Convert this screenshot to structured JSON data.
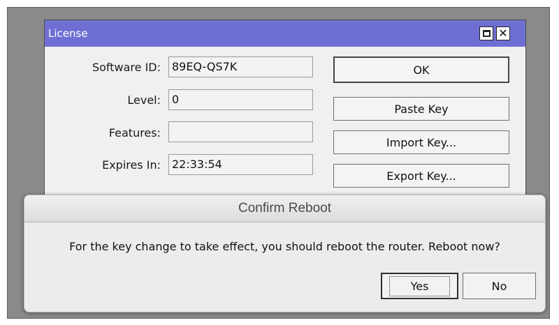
{
  "license_window": {
    "title": "License",
    "fields": [
      {
        "label": "Software ID:",
        "value": "89EQ-QS7K"
      },
      {
        "label": "Level:",
        "value": "0"
      },
      {
        "label": "Features:",
        "value": ""
      },
      {
        "label": "Expires In:",
        "value": "22:33:54"
      }
    ],
    "buttons": {
      "ok": "OK",
      "paste_key": "Paste Key",
      "import_key": "Import Key...",
      "export_key": "Export Key..."
    },
    "colors": {
      "titlebar": "#6f6fd3"
    }
  },
  "confirm_dialog": {
    "title": "Confirm Reboot",
    "message": "For the key change to take effect, you should reboot the router. Reboot now?",
    "yes_label": "Yes",
    "no_label": "No"
  }
}
